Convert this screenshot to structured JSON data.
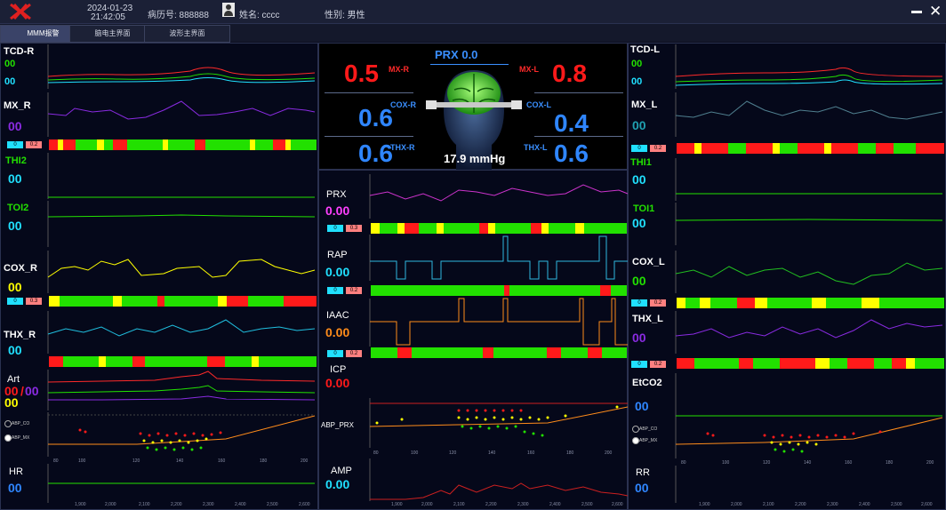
{
  "header": {
    "date": "2024-01-23",
    "time": "21:42:05",
    "record_label": "病历号: 888888",
    "name_label": "姓名: cccc",
    "gender_label": "性别:  男性"
  },
  "tabs": [
    "MMM报警",
    "脑电主界面",
    "波形主界面"
  ],
  "left": {
    "tcd_r": {
      "label": "TCD-R",
      "v1": "00",
      "v2": "00"
    },
    "mx_r": {
      "label": "MX_R",
      "value": "00"
    },
    "mx_r_thr": {
      "low": "0",
      "high": "0.2"
    },
    "thi2": {
      "label": "THI2",
      "value": "00"
    },
    "toi2": {
      "label": "TOI2",
      "value": "00"
    },
    "cox_r": {
      "label": "COX_R",
      "value": "00"
    },
    "cox_r_thr": {
      "low": "0",
      "high": "0.3"
    },
    "thx_r": {
      "label": "THX_R",
      "value": "00"
    },
    "art": {
      "label": "Art",
      "v1": "00",
      "sep": "/",
      "v2": "00",
      "v3": "00"
    },
    "abp_radio": {
      "a": "ABP_CO",
      "b": "ABP_MX"
    },
    "hr": {
      "label": "HR",
      "value": "00"
    }
  },
  "center": {
    "prx_title": "PRX 0.0",
    "mx_r": {
      "label": "MX-R",
      "value": "0.5"
    },
    "mx_l": {
      "label": "MX-L",
      "value": "0.8"
    },
    "cox_r": {
      "label": "COX-R",
      "value": "0.6"
    },
    "cox_l": {
      "label": "COX-L",
      "value": "0.4"
    },
    "thx_r": {
      "label": "THX-R",
      "value": "0.6"
    },
    "thx_l": {
      "label": "THX-L",
      "value": "0.6"
    },
    "pressure": "17.9  mmHg",
    "prx": {
      "label": "PRX",
      "value": "0.00",
      "thr_low": "0",
      "thr_high": "0.3"
    },
    "rap": {
      "label": "RAP",
      "value": "0.00",
      "thr_low": "0",
      "thr_high": "0.2"
    },
    "iaac": {
      "label": "IAAC",
      "value": "0.00",
      "thr_low": "0",
      "thr_high": "0.2"
    },
    "icp": {
      "label": "ICP",
      "value": "0.00"
    },
    "abp_prx": "ABP_PRX",
    "amp": {
      "label": "AMP",
      "value": "0.00"
    }
  },
  "right": {
    "tcd_l": {
      "label": "TCD-L",
      "v1": "00",
      "v2": "00"
    },
    "mx_l": {
      "label": "MX_L",
      "value": "00"
    },
    "thr_mx": {
      "low": "0",
      "high": "0.2"
    },
    "thi1": {
      "label": "THI1",
      "value": "00"
    },
    "toi1": {
      "label": "TOI1",
      "value": "00"
    },
    "cox_l": {
      "label": "COX_L",
      "value": "00"
    },
    "thr_cox": {
      "low": "0",
      "high": "0.2"
    },
    "thx_l": {
      "label": "THX_L",
      "value": "00"
    },
    "thr_thx": {
      "low": "0",
      "high": "0.2"
    },
    "etco2": {
      "label": "EtCO2",
      "value": "00"
    },
    "abp_radio": {
      "a": "ABP_CO",
      "b": "ABP_MX"
    },
    "rr": {
      "label": "RR",
      "value": "00"
    }
  },
  "scatter_x_ticks": [
    "80",
    "100",
    "120",
    "140",
    "160",
    "180",
    "200"
  ],
  "time_ticks": [
    "1,900",
    "2,000",
    "2,100",
    "2,200",
    "2,300",
    "2,400",
    "2,500",
    "2,600"
  ],
  "colors": {
    "red": "#ff1a1a",
    "green": "#22e000",
    "yellow": "#ffff00",
    "blue": "#2f86ff",
    "purple": "#8a2be2",
    "orange": "#ff8c1a",
    "cyan": "#20e0ff"
  }
}
